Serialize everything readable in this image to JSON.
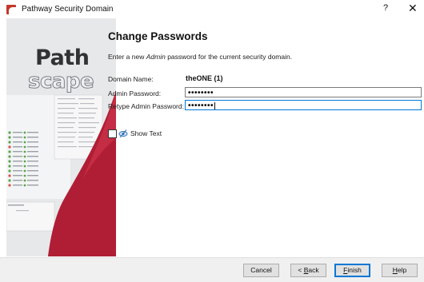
{
  "window": {
    "title": "Pathway Security Domain",
    "help_glyph": "?",
    "close_glyph": "✕",
    "app_icon": "pathway-app-icon"
  },
  "sidebar": {
    "logo_line1": "Path",
    "logo_line2": "scape"
  },
  "main": {
    "title": "Change Passwords",
    "instructions_prefix": "Enter a new ",
    "instructions_emph": "Admin",
    "instructions_suffix": " password for the current security domain.",
    "domain_label": "Domain Name:",
    "domain_value": "theONE (1)",
    "admin_pw_label": "Admin Password:",
    "admin_pw_value": "••••••••",
    "retype_pw_label": "Retype Admin Password:",
    "retype_pw_value": "••••••••",
    "show_text_label": "Show Text",
    "show_text_checked": false,
    "show_text_icon": "eye-hidden-icon"
  },
  "buttons": {
    "cancel": "Cancel",
    "back_prefix": "< ",
    "back_ul": "B",
    "back_rest": "ack",
    "finish_ul": "F",
    "finish_rest": "inish",
    "help_ul": "H",
    "help_rest": "elp"
  },
  "colors": {
    "accent": "#0078d7",
    "brand_red": "#c0392b"
  }
}
